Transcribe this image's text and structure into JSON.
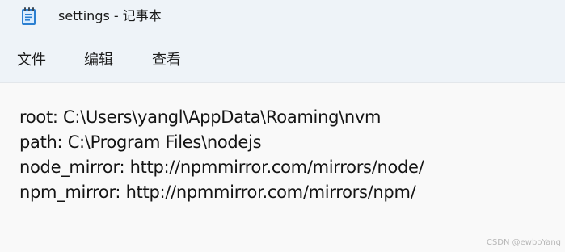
{
  "window": {
    "title": "settings - 记事本",
    "app_icon": "notepad-icon"
  },
  "menu": {
    "file": "文件",
    "edit": "编辑",
    "view": "查看"
  },
  "editor": {
    "lines": [
      "root: C:\\Users\\yangl\\AppData\\Roaming\\nvm",
      "path: C:\\Program Files\\nodejs",
      "node_mirror: http://npmmirror.com/mirrors/node/",
      "npm_mirror: http://npmmirror.com/mirrors/npm/"
    ]
  },
  "watermark": "CSDN @ewboYang"
}
